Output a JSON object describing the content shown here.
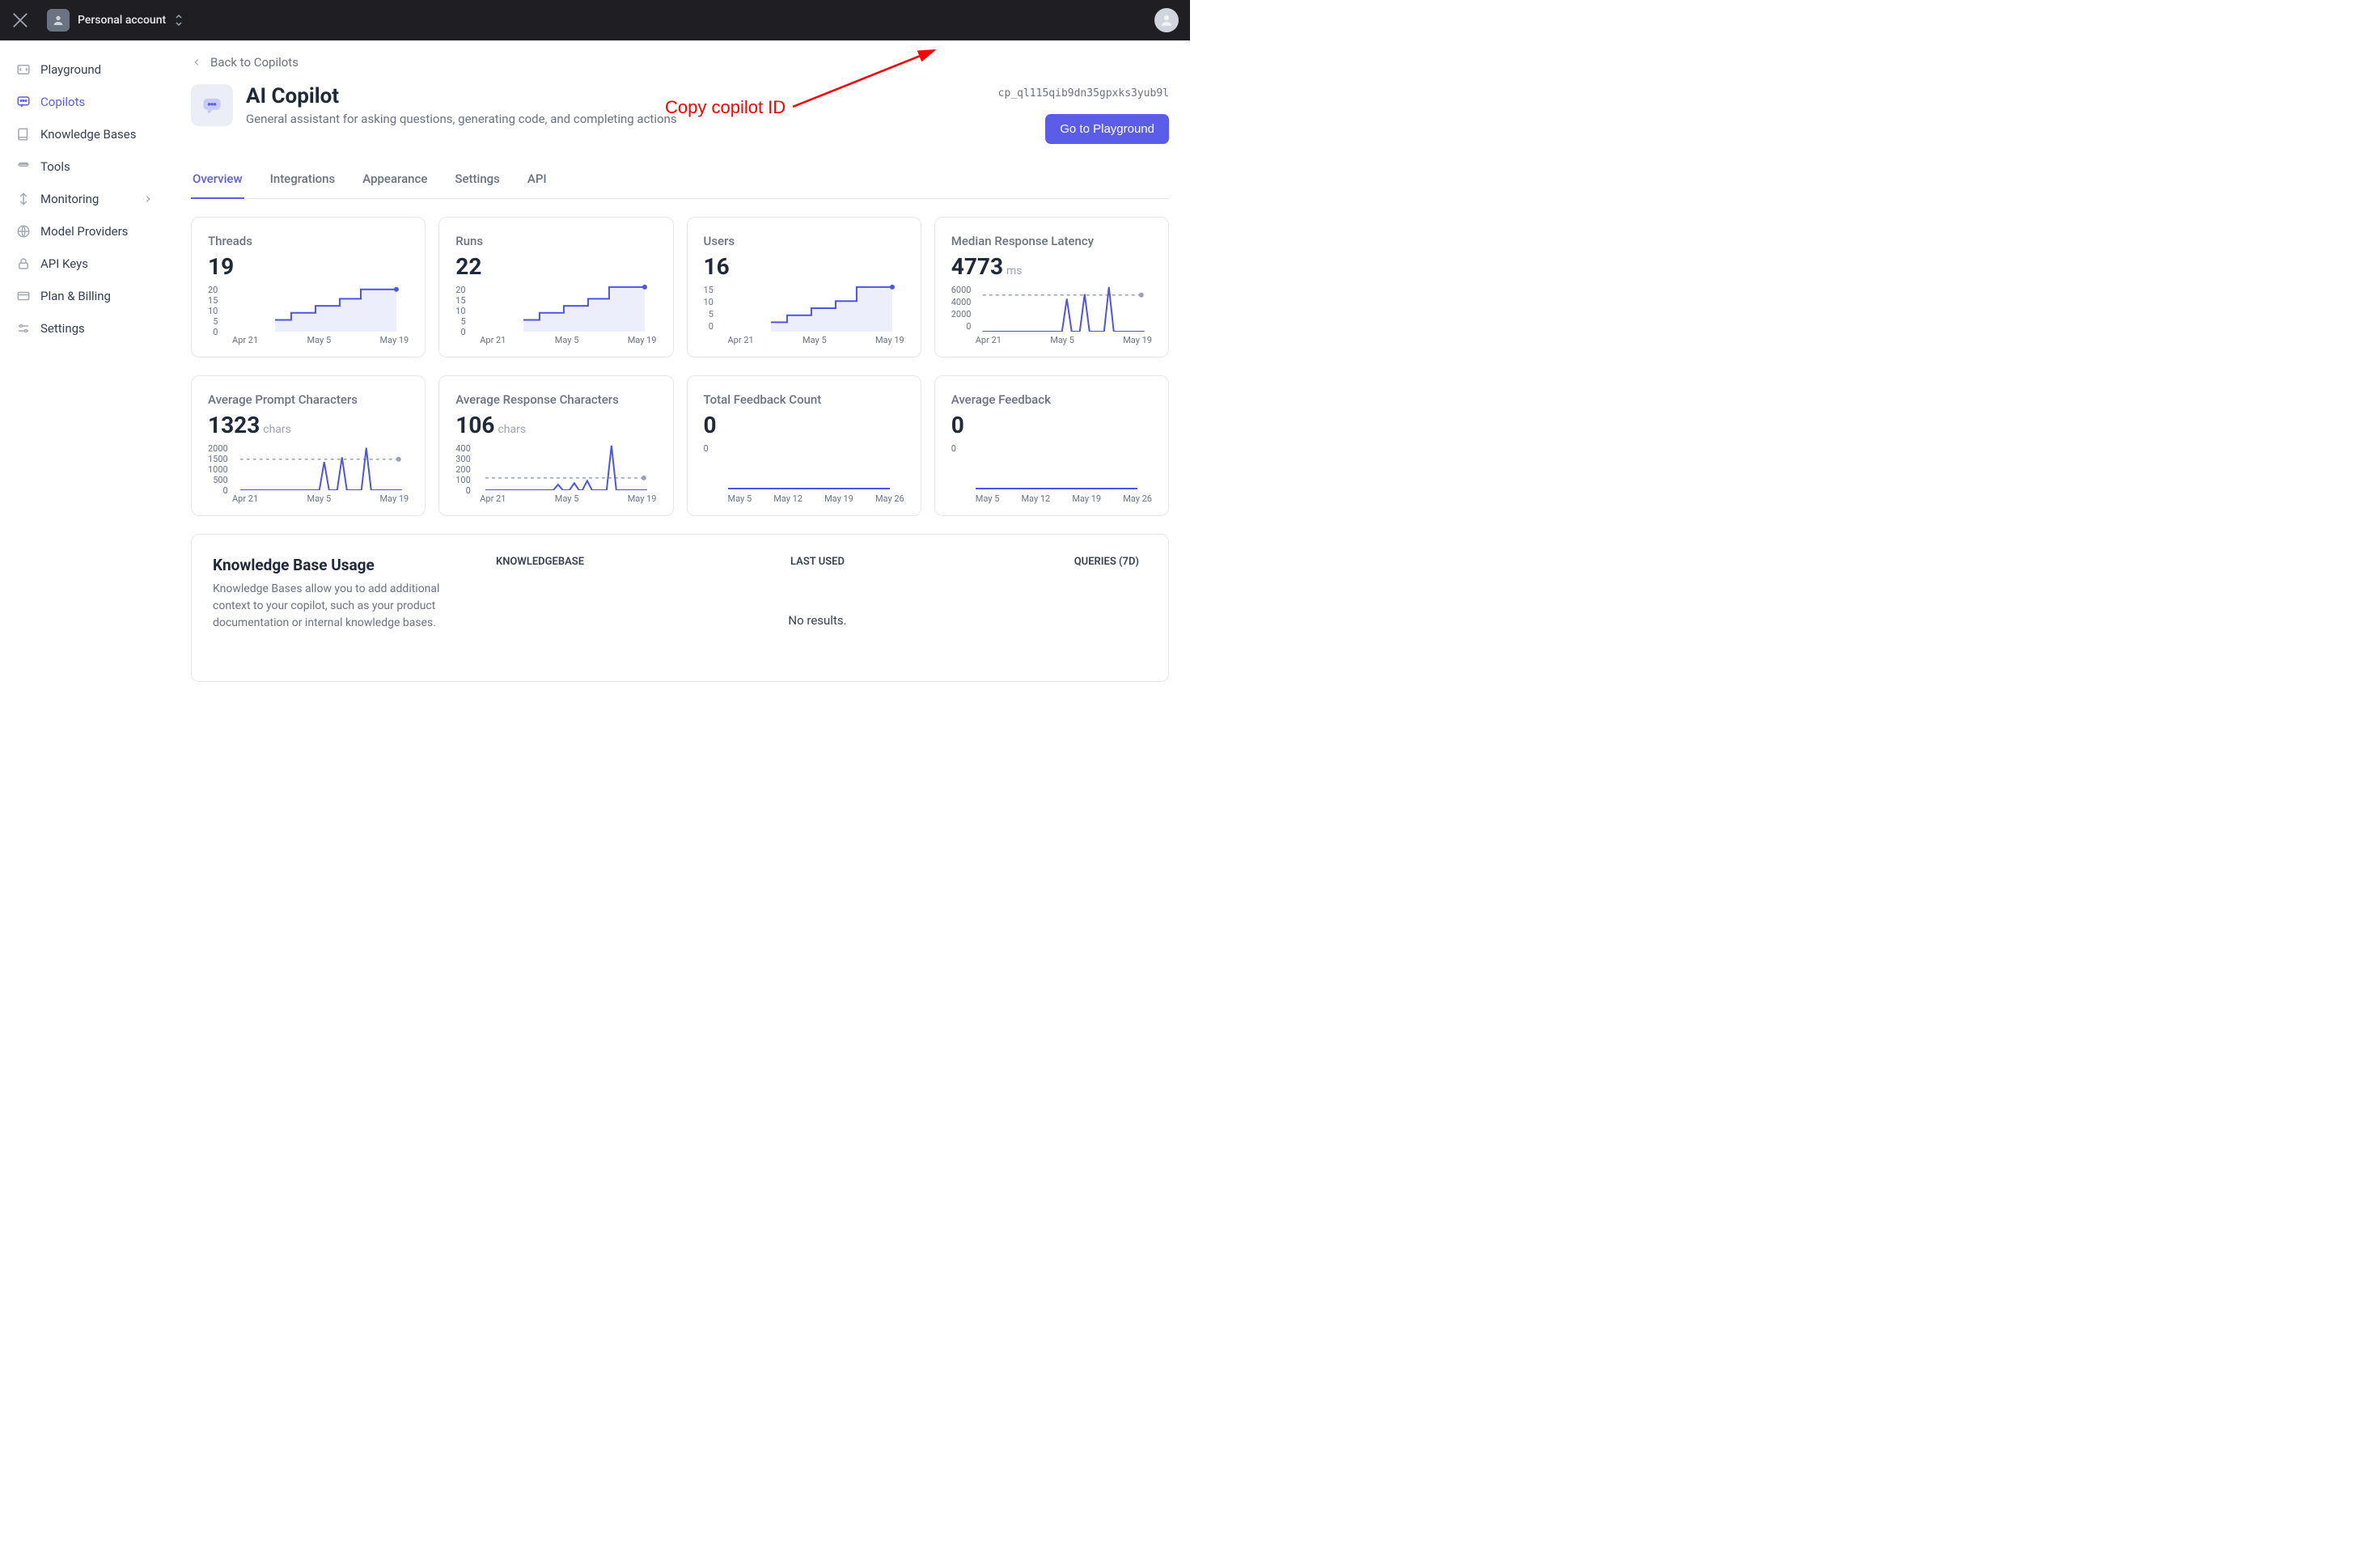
{
  "topbar": {
    "account_label": "Personal account"
  },
  "sidebar": {
    "items": [
      {
        "label": "Playground"
      },
      {
        "label": "Copilots"
      },
      {
        "label": "Knowledge Bases"
      },
      {
        "label": "Tools"
      },
      {
        "label": "Monitoring"
      },
      {
        "label": "Model Providers"
      },
      {
        "label": "API Keys"
      },
      {
        "label": "Plan & Billing"
      },
      {
        "label": "Settings"
      }
    ]
  },
  "page": {
    "back_label": "Back to Copilots",
    "title": "AI Copilot",
    "subtitle": "General assistant for asking questions, generating code, and completing actions",
    "copilot_id": "cp_ql115qib9dn35gpxks3yub9l",
    "playground_btn": "Go to Playground"
  },
  "annotation": {
    "label": "Copy copilot ID"
  },
  "tabs": [
    {
      "label": "Overview",
      "active": true
    },
    {
      "label": "Integrations"
    },
    {
      "label": "Appearance"
    },
    {
      "label": "Settings"
    },
    {
      "label": "API"
    }
  ],
  "cards_row1": [
    {
      "title": "Threads",
      "value": "19",
      "unit": "",
      "y_ticks": [
        "20",
        "15",
        "10",
        "5",
        "0"
      ],
      "x_ticks": [
        "Apr 21",
        "May  5",
        "May 19"
      ],
      "chart": {
        "type": "step-area",
        "avg_line": null,
        "points": [
          [
            0.25,
            0.25
          ],
          [
            0.35,
            0.25
          ],
          [
            0.35,
            0.4
          ],
          [
            0.5,
            0.4
          ],
          [
            0.5,
            0.55
          ],
          [
            0.65,
            0.55
          ],
          [
            0.65,
            0.7
          ],
          [
            0.78,
            0.7
          ],
          [
            0.78,
            0.9
          ],
          [
            1,
            0.9
          ]
        ]
      }
    },
    {
      "title": "Runs",
      "value": "22",
      "unit": "",
      "y_ticks": [
        "20",
        "15",
        "10",
        "5",
        "0"
      ],
      "x_ticks": [
        "Apr 21",
        "May  5",
        "May 19"
      ],
      "chart": {
        "type": "step-area",
        "avg_line": null,
        "points": [
          [
            0.25,
            0.25
          ],
          [
            0.35,
            0.25
          ],
          [
            0.35,
            0.4
          ],
          [
            0.5,
            0.4
          ],
          [
            0.5,
            0.55
          ],
          [
            0.65,
            0.55
          ],
          [
            0.65,
            0.7
          ],
          [
            0.78,
            0.7
          ],
          [
            0.78,
            0.95
          ],
          [
            1,
            0.95
          ]
        ]
      }
    },
    {
      "title": "Users",
      "value": "16",
      "unit": "",
      "y_ticks": [
        "15",
        "10",
        "5",
        "0"
      ],
      "x_ticks": [
        "Apr 21",
        "May  5",
        "May 19"
      ],
      "chart": {
        "type": "step-area",
        "avg_line": null,
        "points": [
          [
            0.25,
            0.2
          ],
          [
            0.35,
            0.2
          ],
          [
            0.35,
            0.35
          ],
          [
            0.5,
            0.35
          ],
          [
            0.5,
            0.5
          ],
          [
            0.65,
            0.5
          ],
          [
            0.65,
            0.65
          ],
          [
            0.78,
            0.65
          ],
          [
            0.78,
            0.95
          ],
          [
            1,
            0.95
          ]
        ]
      }
    },
    {
      "title": "Median Response Latency",
      "value": "4773",
      "unit": "ms",
      "y_ticks": [
        "6000",
        "4000",
        "2000",
        "0"
      ],
      "x_ticks": [
        "Apr 21",
        "May  5",
        "May 19"
      ],
      "chart": {
        "type": "spike",
        "avg_line": 0.78,
        "spikes": [
          [
            0.52,
            0.7
          ],
          [
            0.63,
            0.8
          ],
          [
            0.78,
            0.95
          ]
        ]
      }
    }
  ],
  "cards_row2": [
    {
      "title": "Average Prompt Characters",
      "value": "1323",
      "unit": "chars",
      "y_ticks": [
        "2000",
        "1500",
        "1000",
        "500",
        "0"
      ],
      "x_ticks": [
        "Apr 21",
        "May  5",
        "May 19"
      ],
      "chart": {
        "type": "spike",
        "avg_line": 0.66,
        "spikes": [
          [
            0.52,
            0.6
          ],
          [
            0.63,
            0.7
          ],
          [
            0.78,
            0.9
          ]
        ]
      }
    },
    {
      "title": "Average Response Characters",
      "value": "106",
      "unit": "chars",
      "y_ticks": [
        "400",
        "300",
        "200",
        "100",
        "0"
      ],
      "x_ticks": [
        "Apr 21",
        "May  5",
        "May 19"
      ],
      "chart": {
        "type": "spike",
        "avg_line": 0.26,
        "spikes": [
          [
            0.45,
            0.12
          ],
          [
            0.55,
            0.15
          ],
          [
            0.63,
            0.2
          ],
          [
            0.78,
            0.95
          ]
        ]
      }
    },
    {
      "title": "Total Feedback Count",
      "value": "0",
      "unit": "",
      "y_ticks": [
        "0"
      ],
      "x_ticks": [
        "May  5",
        "May 12",
        "May 19",
        "May 26"
      ],
      "chart": {
        "type": "flat"
      }
    },
    {
      "title": "Average Feedback",
      "value": "0",
      "unit": "",
      "y_ticks": [
        "0"
      ],
      "x_ticks": [
        "May  5",
        "May 12",
        "May 19",
        "May 26"
      ],
      "chart": {
        "type": "flat"
      }
    }
  ],
  "chart_data": [
    {
      "type": "line",
      "title": "Threads",
      "ylim": [
        0,
        20
      ],
      "categories": [
        "Apr 21",
        "May 5",
        "May 19"
      ],
      "values_approx": [
        0,
        5,
        8,
        11,
        14,
        18,
        19
      ]
    },
    {
      "type": "line",
      "title": "Runs",
      "ylim": [
        0,
        20
      ],
      "categories": [
        "Apr 21",
        "May 5",
        "May 19"
      ],
      "values_approx": [
        0,
        5,
        8,
        11,
        14,
        20,
        22
      ]
    },
    {
      "type": "line",
      "title": "Users",
      "ylim": [
        0,
        15
      ],
      "categories": [
        "Apr 21",
        "May 5",
        "May 19"
      ],
      "values_approx": [
        0,
        3,
        5,
        8,
        10,
        15,
        16
      ]
    },
    {
      "type": "line",
      "title": "Median Response Latency",
      "ylabel": "ms",
      "ylim": [
        0,
        6000
      ],
      "categories": [
        "Apr 21",
        "May 5",
        "May 19"
      ],
      "values_approx": [
        0,
        0,
        4200,
        0,
        4800,
        0,
        5700,
        0
      ],
      "avg": 4773
    },
    {
      "type": "line",
      "title": "Average Prompt Characters",
      "ylabel": "chars",
      "ylim": [
        0,
        2000
      ],
      "categories": [
        "Apr 21",
        "May 5",
        "May 19"
      ],
      "values_approx": [
        0,
        0,
        1200,
        0,
        1400,
        0,
        1800,
        0
      ],
      "avg": 1323
    },
    {
      "type": "line",
      "title": "Average Response Characters",
      "ylabel": "chars",
      "ylim": [
        0,
        400
      ],
      "categories": [
        "Apr 21",
        "May 5",
        "May 19"
      ],
      "values_approx": [
        0,
        50,
        60,
        80,
        380,
        0
      ],
      "avg": 106
    },
    {
      "type": "line",
      "title": "Total Feedback Count",
      "ylim": [
        0,
        0
      ],
      "categories": [
        "May 5",
        "May 12",
        "May 19",
        "May 26"
      ],
      "values": [
        0,
        0,
        0,
        0
      ]
    },
    {
      "type": "line",
      "title": "Average Feedback",
      "ylim": [
        0,
        0
      ],
      "categories": [
        "May 5",
        "May 12",
        "May 19",
        "May 26"
      ],
      "values": [
        0,
        0,
        0,
        0
      ]
    }
  ],
  "kb": {
    "title": "Knowledge Base Usage",
    "desc": "Knowledge Bases allow you to add additional context to your copilot, such as your product documentation or internal knowledge bases.",
    "columns": [
      "KNOWLEDGEBASE",
      "LAST USED",
      "QUERIES (7D)"
    ],
    "empty": "No results."
  }
}
